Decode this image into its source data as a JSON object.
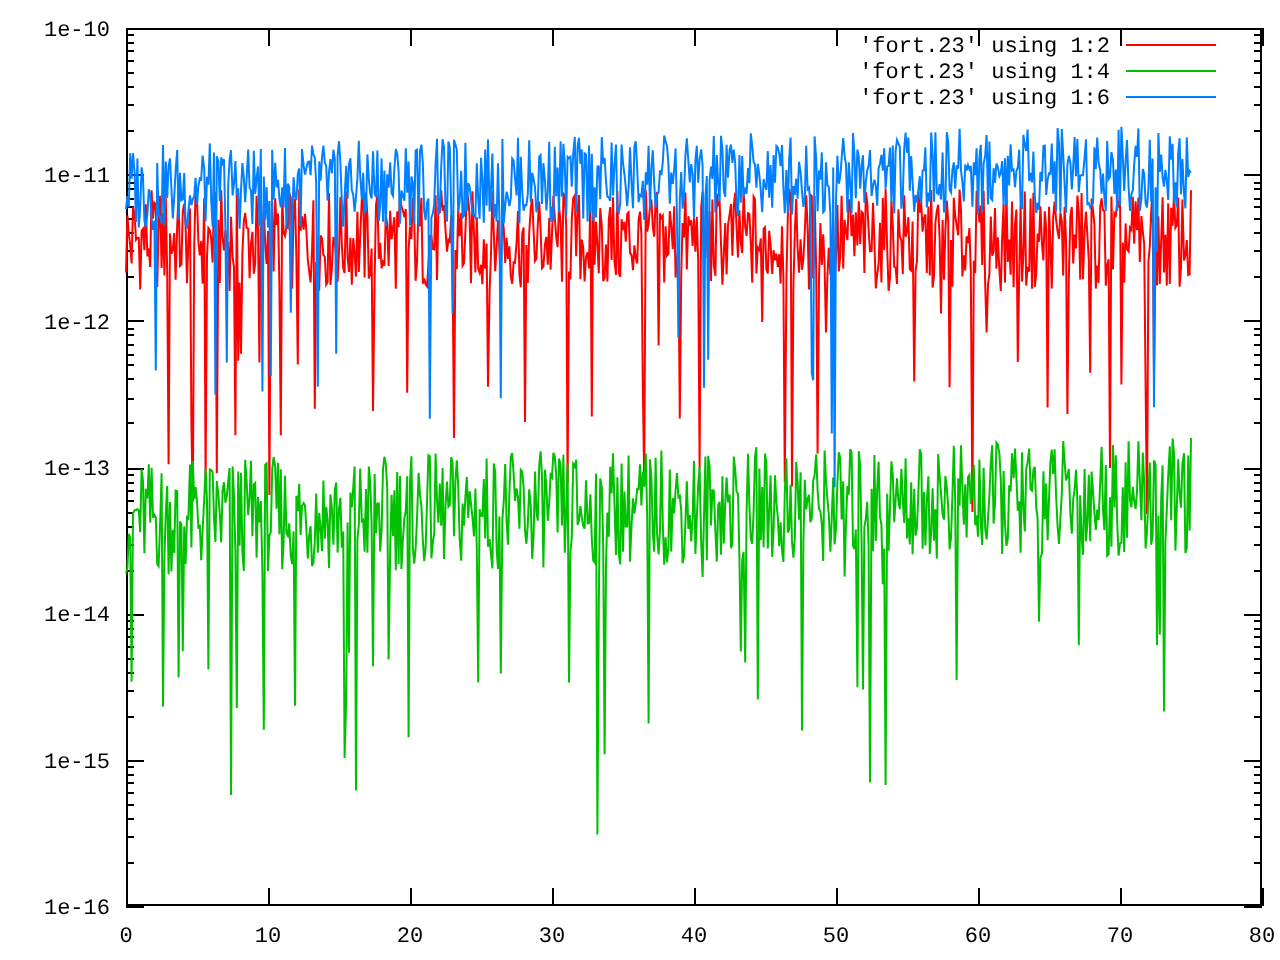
{
  "plot": {
    "y_tick_labels": [
      "1e-10",
      "1e-11",
      "1e-12",
      "1e-13",
      "1e-14",
      "1e-15",
      "1e-16"
    ],
    "x_tick_labels": [
      "0",
      "10",
      "20",
      "30",
      "40",
      "50",
      "60",
      "70",
      "80"
    ],
    "legend": [
      {
        "label": "'fort.23' using 1:2",
        "color": "#ff0000"
      },
      {
        "label": "'fort.23' using 1:4",
        "color": "#00c000"
      },
      {
        "label": "'fort.23' using 1:6",
        "color": "#0080ff"
      }
    ]
  }
}
